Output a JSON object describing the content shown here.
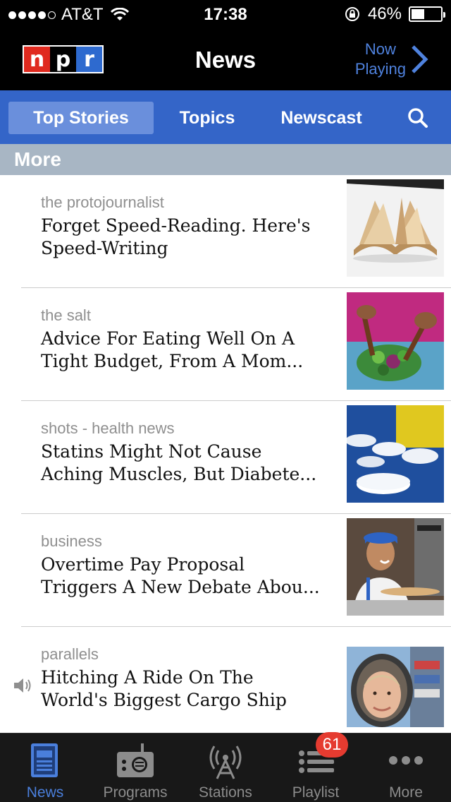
{
  "status_bar": {
    "carrier": "AT&T",
    "time": "17:38",
    "battery_percent": "46%",
    "battery_level": 0.46,
    "signal_bars_filled": 4,
    "signal_bars_total": 5
  },
  "nav": {
    "logo_letters": [
      "n",
      "p",
      "r"
    ],
    "title": "News",
    "now_playing_line1": "Now",
    "now_playing_line2": "Playing"
  },
  "tabs": [
    {
      "label": "Top Stories",
      "active": true
    },
    {
      "label": "Topics",
      "active": false
    },
    {
      "label": "Newscast",
      "active": false
    }
  ],
  "section_header": "More",
  "stories": [
    {
      "category": "the protojournalist",
      "headline": "Forget Speed-Reading. Here's\nSpeed-Writing",
      "playing": false
    },
    {
      "category": "the salt",
      "headline": "Advice For Eating Well On A\nTight Budget, From A Mom...",
      "playing": false
    },
    {
      "category": "shots - health news",
      "headline": "Statins Might Not Cause\nAching Muscles, But Diabete...",
      "playing": false
    },
    {
      "category": "business",
      "headline": "Overtime Pay Proposal\nTriggers A New Debate Abou...",
      "playing": false
    },
    {
      "category": "parallels",
      "headline": "Hitching A Ride On The\nWorld's Biggest Cargo Ship",
      "playing": true
    }
  ],
  "bottom_tabs": [
    {
      "label": "News",
      "icon": "news-icon",
      "active": true
    },
    {
      "label": "Programs",
      "icon": "radio-icon",
      "active": false
    },
    {
      "label": "Stations",
      "icon": "antenna-icon",
      "active": false
    },
    {
      "label": "Playlist",
      "icon": "playlist-icon",
      "active": false,
      "badge": "61"
    },
    {
      "label": "More",
      "icon": "more-dots-icon",
      "active": false
    }
  ],
  "colors": {
    "nav_blue": "#3465c8",
    "active_tab": "#6a8fdc",
    "accent": "#4a7fdc",
    "badge": "#e53b30",
    "npr_red": "#e0291e",
    "npr_blue": "#2e6acf"
  }
}
